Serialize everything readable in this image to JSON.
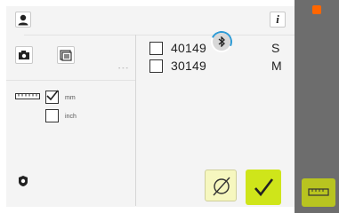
{
  "header": {
    "user_icon": "user-icon",
    "info_icon": "info-icon",
    "info_label": "i"
  },
  "left_panel": {
    "units": [
      {
        "label": "mm",
        "checked": true
      },
      {
        "label": "inch",
        "checked": false
      }
    ]
  },
  "separator_label": "- - -",
  "items": [
    {
      "number": "40149",
      "size": "S",
      "checked": false
    },
    {
      "number": "30149",
      "size": "M",
      "checked": false
    }
  ],
  "colors": {
    "accent": "#cfe51a",
    "cancel_bg": "#f6f7bf",
    "side_bg": "#6d6d6d",
    "orange": "#ff6600",
    "bluetooth_blue": "#2d9bd6"
  }
}
